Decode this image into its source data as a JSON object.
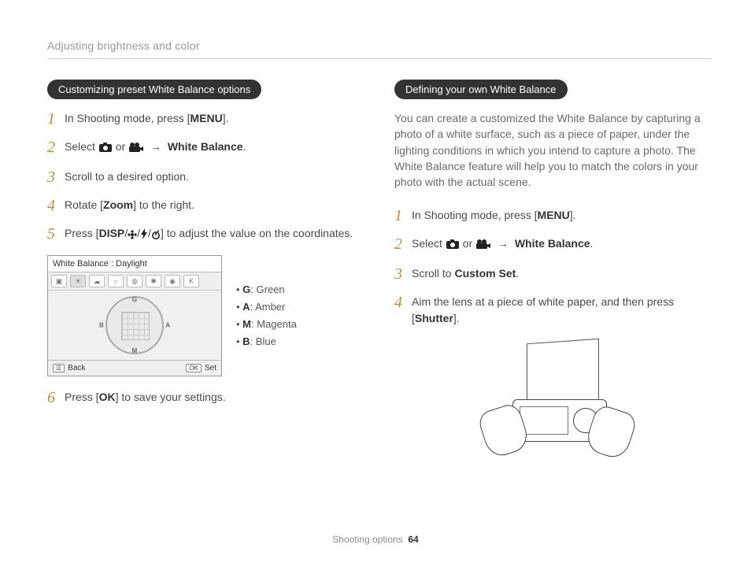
{
  "header": "Adjusting brightness and color",
  "footer": {
    "section": "Shooting options",
    "page": "64"
  },
  "left": {
    "pill": "Customizing preset White Balance options",
    "steps": {
      "s1a": "In Shooting mode, press [",
      "s1b": "MENU",
      "s1c": "].",
      "s2a": "Select ",
      "s2b": " or ",
      "s2arrow": "→",
      "s2c": "White Balance",
      "s2d": ".",
      "s3": "Scroll to a desired option.",
      "s4a": "Rotate [",
      "s4b": "Zoom",
      "s4c": "] to the right.",
      "s5a": "Press [",
      "s5b": "DISP",
      "s5c": "/",
      "s5icon1": "flower",
      "s5c2": "/",
      "s5icon2": "flash",
      "s5c3": "/",
      "s5icon3": "timer",
      "s5d": "] to adjust the value on the coordinates.",
      "s6a": "Press [",
      "s6b": "OK",
      "s6c": "] to save your settings."
    },
    "lcd": {
      "title": "White Balance : Daylight",
      "back": "Back",
      "set": "Set",
      "backKey": "☰",
      "setKey": "OK",
      "dial": {
        "g": "G",
        "a": "A",
        "m": "M",
        "b": "B"
      },
      "iconRow": [
        "▣",
        "☀",
        "☁",
        "☼",
        "◍",
        "✺",
        "◉",
        "K"
      ]
    },
    "legend": {
      "g_k": "G",
      "g_v": ": Green",
      "a_k": "A",
      "a_v": ": Amber",
      "m_k": "M",
      "m_v": ": Magenta",
      "b_k": "B",
      "b_v": ": Blue"
    }
  },
  "right": {
    "pill": "Defining your own White Balance",
    "intro": "You can create a customized the White Balance by capturing a photo of a white surface, such as a piece of paper, under the lighting conditions in which you intend to capture a photo. The White Balance feature will help you to match the colors in your photo with the actual scene.",
    "steps": {
      "s1a": "In Shooting mode, press [",
      "s1b": "MENU",
      "s1c": "].",
      "s2a": "Select ",
      "s2b": " or ",
      "s2arrow": "→",
      "s2c": "White Balance",
      "s2d": ".",
      "s3a": "Scroll to ",
      "s3b": "Custom Set",
      "s3c": ".",
      "s4a": "Aim the lens at a piece of white paper, and then press [",
      "s4b": "Shutter",
      "s4c": "]."
    }
  }
}
